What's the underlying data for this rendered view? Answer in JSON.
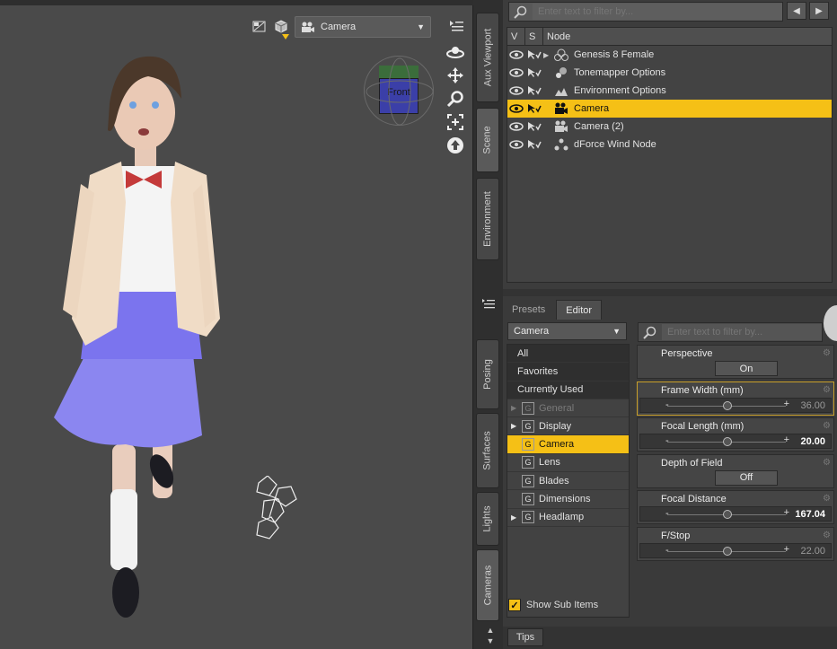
{
  "viewport": {
    "camera_select": "Camera",
    "nav_cube_label": "Front"
  },
  "side_tabs_top": [
    "Aux Viewport",
    "Scene",
    "Environment"
  ],
  "side_tabs_bottom": [
    "Posing",
    "Surfaces",
    "Lights",
    "Cameras"
  ],
  "scene": {
    "search_placeholder": "Enter text to filter by...",
    "header": {
      "v": "V",
      "s": "S",
      "node": "Node"
    },
    "rows": [
      {
        "label": "Genesis 8 Female",
        "icon": "figure-icon",
        "expandable": true
      },
      {
        "label": "Tonemapper Options",
        "icon": "tonemapper-icon",
        "expandable": false
      },
      {
        "label": "Environment Options",
        "icon": "environment-icon",
        "expandable": false
      },
      {
        "label": "Camera",
        "icon": "camera-icon",
        "expandable": false,
        "selected": true
      },
      {
        "label": "Camera (2)",
        "icon": "camera-icon",
        "expandable": false
      },
      {
        "label": "dForce Wind Node",
        "icon": "wind-node-icon",
        "expandable": false
      }
    ]
  },
  "params": {
    "tabs": [
      "Presets",
      "Editor"
    ],
    "active_tab": "Editor",
    "node_select": "Camera",
    "search_placeholder": "Enter text to filter by...",
    "groups": [
      {
        "label": "All",
        "style": "dark"
      },
      {
        "label": "Favorites",
        "style": "dark"
      },
      {
        "label": "Currently Used",
        "style": "dark"
      },
      {
        "label": "General",
        "style": "disabled",
        "expandable": true,
        "g": "G"
      },
      {
        "label": "Display",
        "style": "normal",
        "expandable": true,
        "g": "G"
      },
      {
        "label": "Camera",
        "style": "selected",
        "expandable": false,
        "g": "G"
      },
      {
        "label": "Lens",
        "style": "normal",
        "expandable": false,
        "g": "G"
      },
      {
        "label": "Blades",
        "style": "normal",
        "expandable": false,
        "g": "G"
      },
      {
        "label": "Dimensions",
        "style": "normal",
        "expandable": false,
        "g": "G"
      },
      {
        "label": "Headlamp",
        "style": "normal",
        "expandable": true,
        "g": "G"
      }
    ],
    "show_sub_items": "Show Sub Items",
    "properties": [
      {
        "label": "Perspective",
        "kind": "toggle",
        "value": "On"
      },
      {
        "label": "Frame Width (mm)",
        "kind": "slider",
        "value": "36.00",
        "fraction": 0.5,
        "bold": false,
        "highlight": true
      },
      {
        "label": "Focal Length (mm)",
        "kind": "slider",
        "value": "20.00",
        "fraction": 0.5,
        "bold": true
      },
      {
        "label": "Depth of Field",
        "kind": "toggle",
        "value": "Off"
      },
      {
        "label": "Focal Distance",
        "kind": "slider",
        "value": "167.04",
        "fraction": 0.5,
        "bold": true
      },
      {
        "label": "F/Stop",
        "kind": "slider",
        "value": "22.00",
        "fraction": 0.5,
        "bold": false
      }
    ]
  },
  "tips_label": "Tips",
  "colors": {
    "accent": "#f5c016"
  }
}
